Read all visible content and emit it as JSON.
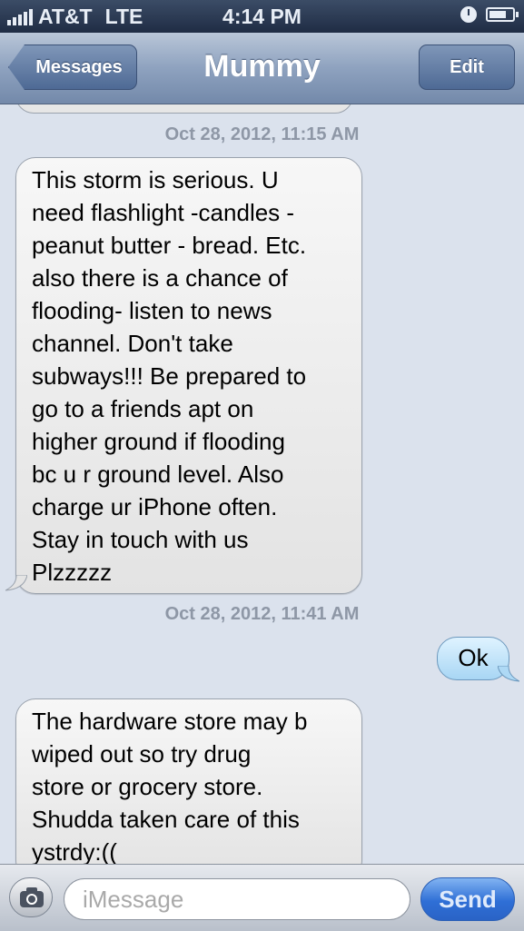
{
  "status_bar": {
    "carrier": "AT&T",
    "network": "LTE",
    "time": "4:14 PM",
    "icons": [
      "signal-bars-icon",
      "clock-icon",
      "battery-icon"
    ]
  },
  "nav": {
    "back_label": "Messages",
    "title": "Mummy",
    "edit_label": "Edit"
  },
  "thread": {
    "timestamps": [
      "Oct 28, 2012, 11:15 AM",
      "Oct 28, 2012, 11:41 AM"
    ],
    "messages": [
      {
        "direction": "incoming",
        "text": "This storm is serious. U\nneed flashlight -candles -\npeanut butter - bread. Etc.\nalso there is a chance of\nflooding- listen to news\nchannel. Don't take\nsubways!!! Be prepared to\ngo to a friends apt on\nhigher ground if flooding\nbc u r ground level. Also\ncharge ur iPhone often.\nStay in touch with us\nPlzzzzz"
      },
      {
        "direction": "outgoing",
        "text": "Ok"
      },
      {
        "direction": "incoming",
        "text": "The hardware store may b\nwiped out so try drug\nstore or grocery store.\nShudda taken care of this\nystrdy:(("
      }
    ]
  },
  "input_bar": {
    "placeholder": "iMessage",
    "value": "",
    "send_label": "Send",
    "camera_icon": "camera-icon"
  },
  "colors": {
    "background": "#dbe2ed",
    "incoming_bubble": "#e8e8e8",
    "outgoing_bubble": "#bfe2fa",
    "send_button": "#2f6fd6"
  }
}
